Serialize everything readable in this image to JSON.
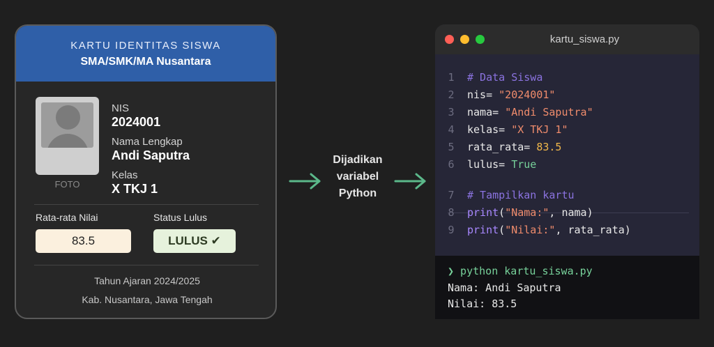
{
  "card": {
    "header_title": "KARTU IDENTITAS SISWA",
    "header_school": "SMA/SMK/MA Nusantara",
    "photo_label": "FOTO",
    "nis_label": "NIS",
    "nis_value": "2024001",
    "nama_label": "Nama Lengkap",
    "nama_value": "Andi Saputra",
    "kelas_label": "Kelas",
    "kelas_value": "X TKJ 1",
    "rata_label": "Rata-rata Nilai",
    "rata_value": "83.5",
    "status_label": "Status Lulus",
    "status_value": "LULUS ✔",
    "footer_year": "Tahun Ajaran 2024/2025",
    "footer_place": "Kab. Nusantara, Jawa Tengah",
    "colors": {
      "header": "#2f5fa8",
      "background": "#272727"
    }
  },
  "middle": {
    "line1": "Dijadikan",
    "line2": "variabel",
    "line3": "Python",
    "arrow_color": "#5bb88a"
  },
  "window": {
    "title": "kartu_siswa.py",
    "dots": [
      "#ff5f56",
      "#ffbd2e",
      "#27c93f"
    ],
    "code": {
      "l1": {
        "num": "1",
        "comment": "# Data Siswa"
      },
      "l2": {
        "num": "2",
        "var": "nis",
        "op": "= ",
        "val": "\"2024001\""
      },
      "l3": {
        "num": "3",
        "var": "nama",
        "op": "= ",
        "val": "\"Andi Saputra\""
      },
      "l4": {
        "num": "4",
        "var": "kelas",
        "op": "= ",
        "val": "\"X TKJ 1\""
      },
      "l5": {
        "num": "5",
        "var": "rata_rata",
        "op": "= ",
        "val": "83.5"
      },
      "l6": {
        "num": "6",
        "var": "lulus",
        "op": "= ",
        "val": "True"
      },
      "l7": {
        "num": "7",
        "comment": "# Tampilkan kartu"
      },
      "l8": {
        "num": "8",
        "fn": "print",
        "open": "(",
        "str": "\"Nama:\"",
        "sep": ", ",
        "arg": "nama",
        "close": ")"
      },
      "l9": {
        "num": "9",
        "fn": "print",
        "open": "(",
        "str": "\"Nilai:\"",
        "sep": ", ",
        "arg": "rata_rata",
        "close": ")"
      }
    },
    "terminal": {
      "cmd": "❯ python kartu_siswa.py",
      "out1": "Nama: Andi Saputra",
      "out2": "Nilai: 83.5"
    }
  }
}
